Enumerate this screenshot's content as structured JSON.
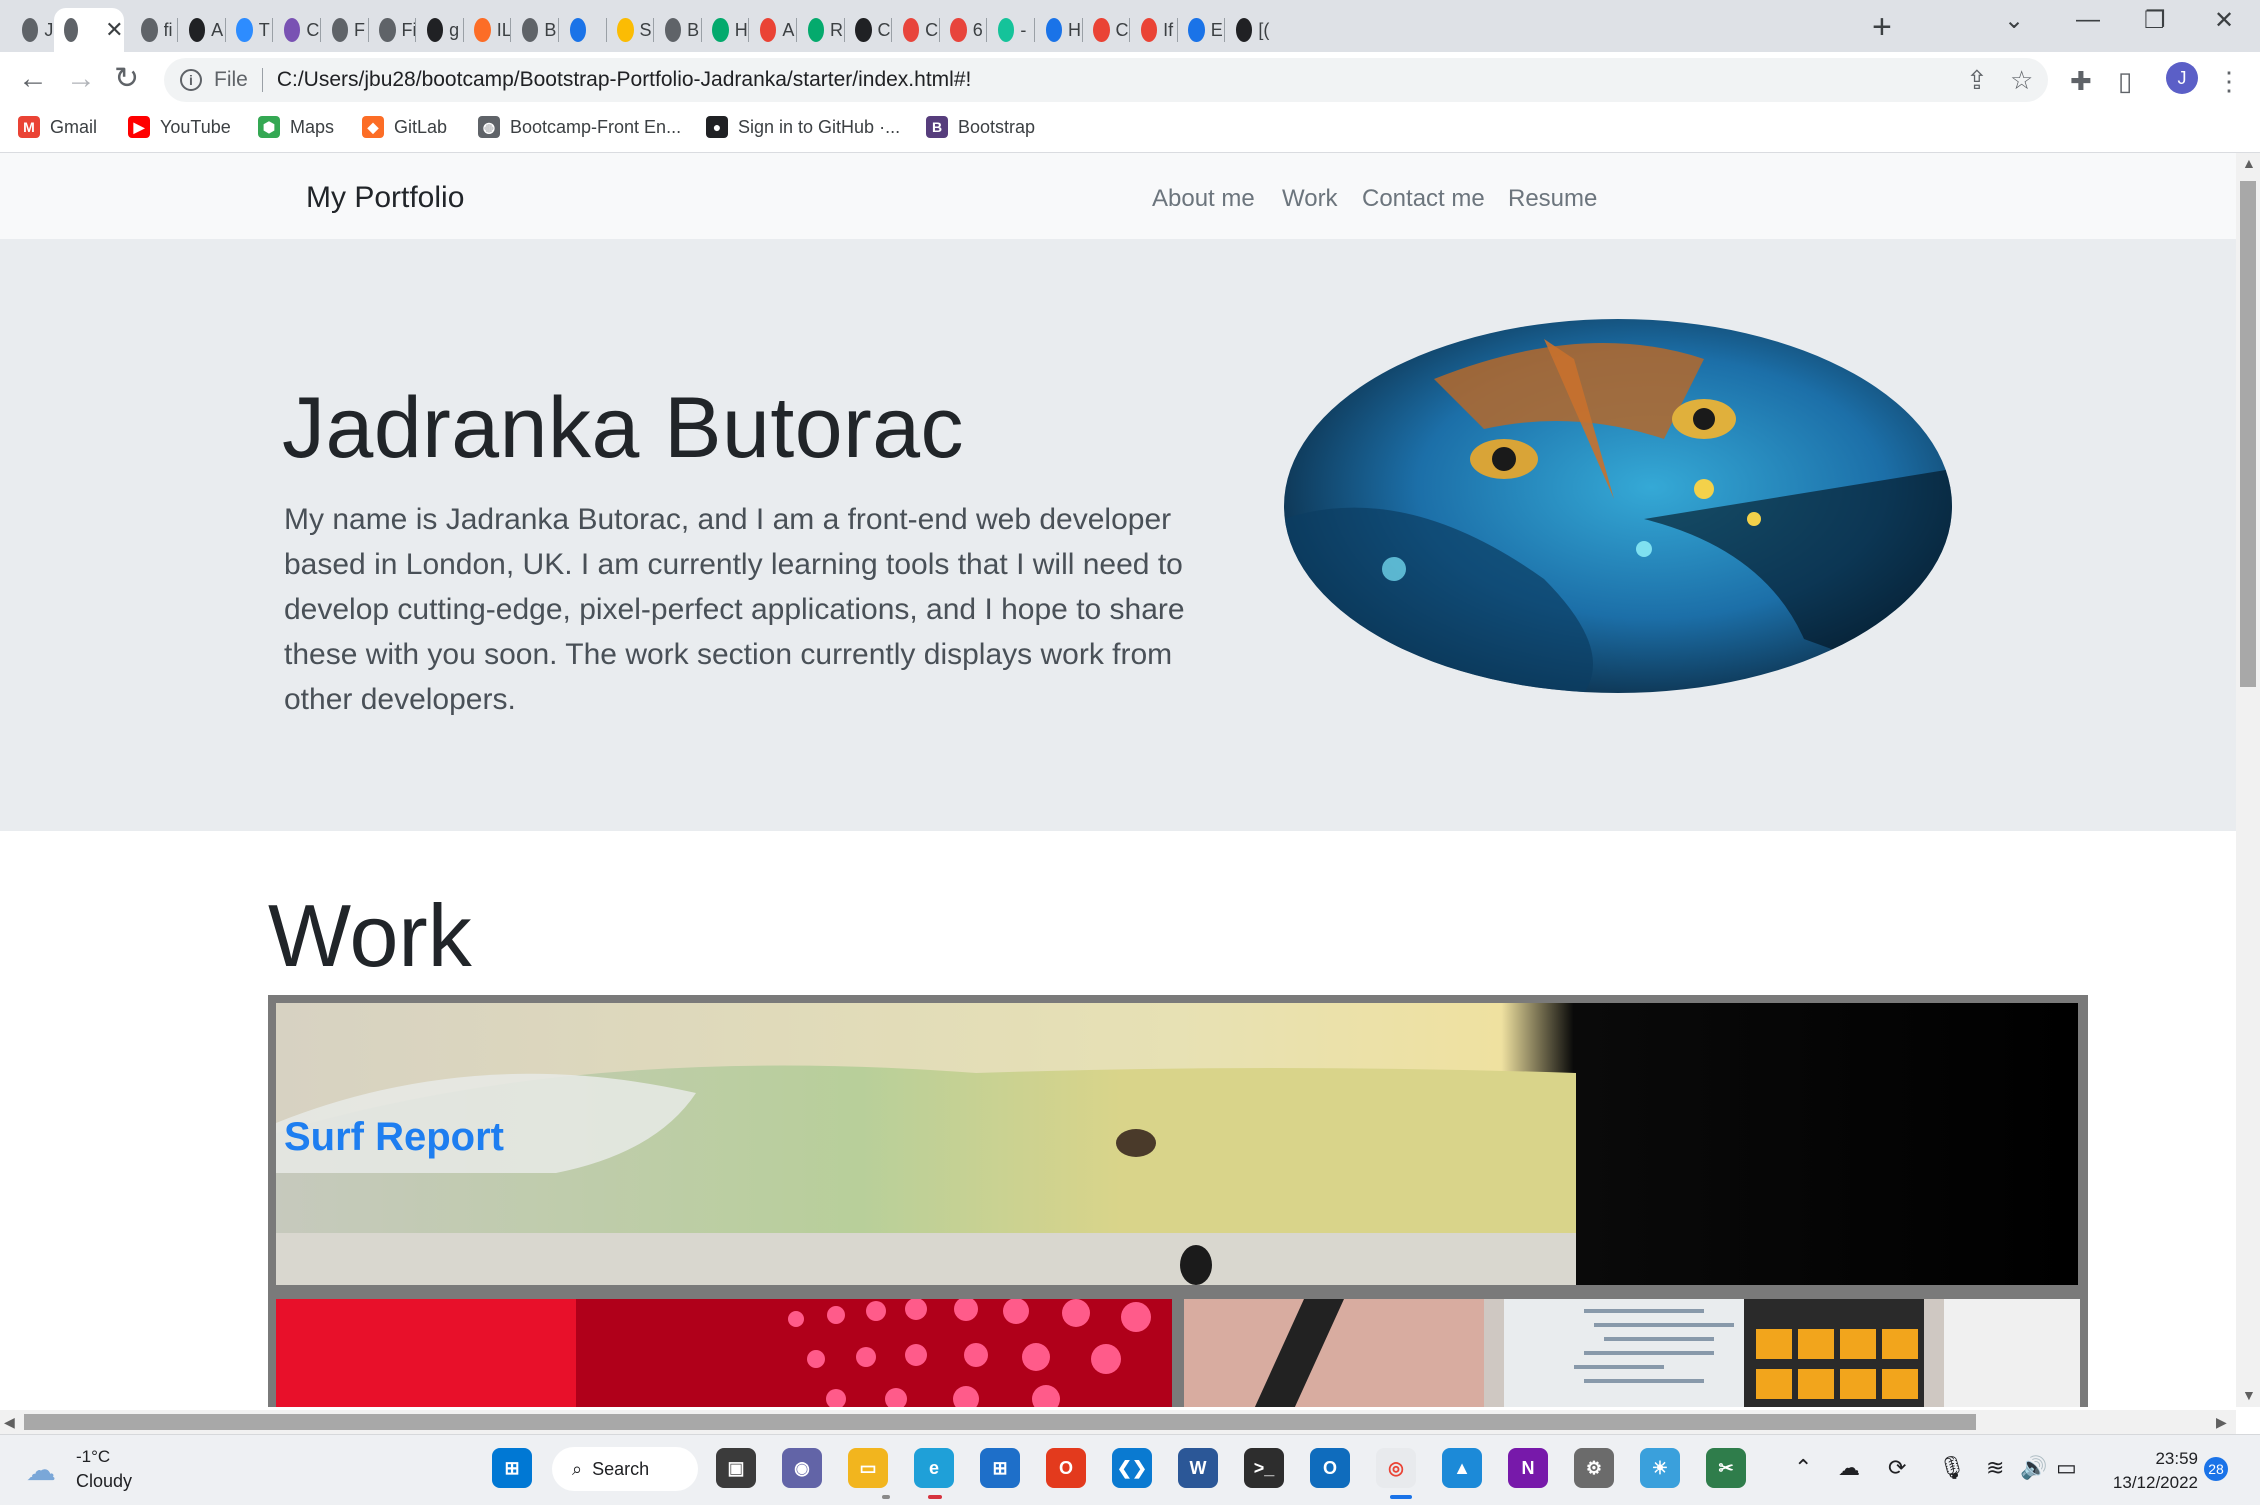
{
  "browser": {
    "tabs": [
      {
        "icon": "globe-icon",
        "title": "Ja",
        "color": "#5f6368"
      },
      {
        "icon": "globe-icon",
        "title": "",
        "color": "#5f6368",
        "active": true
      },
      {
        "icon": "globe-icon",
        "title": "fi",
        "color": "#5f6368"
      },
      {
        "icon": "web-icon",
        "title": "A",
        "color": "#202124"
      },
      {
        "icon": "zoom-icon",
        "title": "T",
        "color": "#2d8cff"
      },
      {
        "icon": "bootstrap-icon",
        "title": "C",
        "color": "#7952b3"
      },
      {
        "icon": "globe-icon",
        "title": "F",
        "color": "#5f6368"
      },
      {
        "icon": "globe-icon",
        "title": "Fi",
        "color": "#5f6368"
      },
      {
        "icon": "m-icon",
        "title": "g",
        "color": "#202124"
      },
      {
        "icon": "gitlab-icon",
        "title": "IL",
        "color": "#fc6d26"
      },
      {
        "icon": "globe-icon",
        "title": "B",
        "color": "#5f6368"
      },
      {
        "icon": "screen-icon",
        "title": "",
        "color": "#1a73e8"
      },
      {
        "icon": "drive-icon",
        "title": "S",
        "color": "#fbbc04"
      },
      {
        "icon": "globe-icon",
        "title": "B",
        "color": "#5f6368"
      },
      {
        "icon": "w-icon",
        "title": "H",
        "color": "#04aa6d"
      },
      {
        "icon": "arrow-icon",
        "title": "A",
        "color": "#ea4335"
      },
      {
        "icon": "w-icon",
        "title": "R",
        "color": "#04aa6d"
      },
      {
        "icon": "video-icon",
        "title": "C",
        "color": "#202124"
      },
      {
        "icon": "asterisk-icon",
        "title": "C",
        "color": "#e8453c"
      },
      {
        "icon": "asterisk-icon",
        "title": "6",
        "color": "#e8453c"
      },
      {
        "icon": "grammarly-icon",
        "title": "-",
        "color": "#15c39a"
      },
      {
        "icon": "globe-icon",
        "title": "H",
        "color": "#1a73e8"
      },
      {
        "icon": "arrow-icon",
        "title": "C",
        "color": "#ea4335"
      },
      {
        "icon": "arrow-icon",
        "title": "If",
        "color": "#ea4335"
      },
      {
        "icon": "puzzle-icon",
        "title": "E",
        "color": "#1a73e8"
      },
      {
        "icon": "terminal-icon",
        "title": "[(",
        "color": "#202124"
      }
    ],
    "url_scheme": "File",
    "url": "C:/Users/jbu28/bootcamp/Bootstrap-Portfolio-Jadranka/starter/index.html#!",
    "profile_initial": "J",
    "bookmarks": [
      {
        "label": "Gmail",
        "icon": "gmail-icon",
        "color": "#ea4335",
        "glyph": "M"
      },
      {
        "label": "YouTube",
        "icon": "youtube-icon",
        "color": "#ff0000",
        "glyph": "▶"
      },
      {
        "label": "Maps",
        "icon": "maps-icon",
        "color": "#34a853",
        "glyph": "⬢"
      },
      {
        "label": "GitLab",
        "icon": "gitlab-icon",
        "color": "#fc6d26",
        "glyph": "◆"
      },
      {
        "label": "Bootcamp-Front En...",
        "icon": "globe-icon",
        "color": "#5f6368",
        "glyph": "◍"
      },
      {
        "label": "Sign in to GitHub ·...",
        "icon": "github-icon",
        "color": "#202124",
        "glyph": "●"
      },
      {
        "label": "Bootstrap",
        "icon": "bootstrap-icon",
        "color": "#563d7c",
        "glyph": "B"
      }
    ]
  },
  "site": {
    "brand": "My Portfolio",
    "nav": [
      "About me",
      "Work",
      "Contact me",
      "Resume"
    ],
    "hero_title": "Jadranka Butorac",
    "hero_text": "My name is Jadranka Butorac, and I am a front-end web developer based in London, UK. I am currently learning tools that I will need to develop cutting-edge, pixel-perfect applications, and I hope to share these with you soon. The work section currently displays work from other developers.",
    "work_title": "Work",
    "projects": [
      {
        "label": "Surf Report"
      }
    ]
  },
  "taskbar": {
    "weather_temp": "-1°C",
    "weather_desc": "Cloudy",
    "search_label": "Search",
    "time": "23:59",
    "date": "13/12/2022",
    "notifications": "28"
  }
}
